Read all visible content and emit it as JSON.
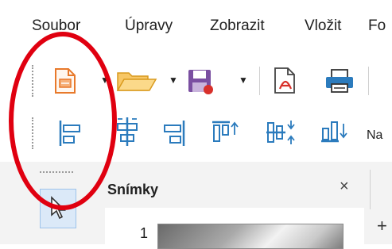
{
  "menu": {
    "items": [
      {
        "label": "Soubor"
      },
      {
        "label": "Úpravy"
      },
      {
        "label": "Zobrazit"
      },
      {
        "label": "Vložit"
      },
      {
        "label": "Fo"
      }
    ]
  },
  "toolbar1": {
    "icons": [
      "new-presentation-icon",
      "open-folder-icon",
      "save-icon",
      "export-pdf-icon",
      "print-icon"
    ],
    "dropdown_glyph": "▼"
  },
  "toolbar2": {
    "icons": [
      "align-left-icon",
      "align-center-icon",
      "align-right-icon",
      "align-top-icon",
      "align-middle-icon",
      "align-bottom-icon"
    ],
    "truncated_label": "Na"
  },
  "slides_panel": {
    "title": "Snímky",
    "close_glyph": "×",
    "slide_number": "1",
    "right_mark": "+"
  },
  "colors": {
    "annotation": "#e00010",
    "icon_blue": "#2b7bbd",
    "accent_orange": "#e8792b",
    "save_purple": "#7a4fa1",
    "pdf_red": "#d8302a"
  }
}
